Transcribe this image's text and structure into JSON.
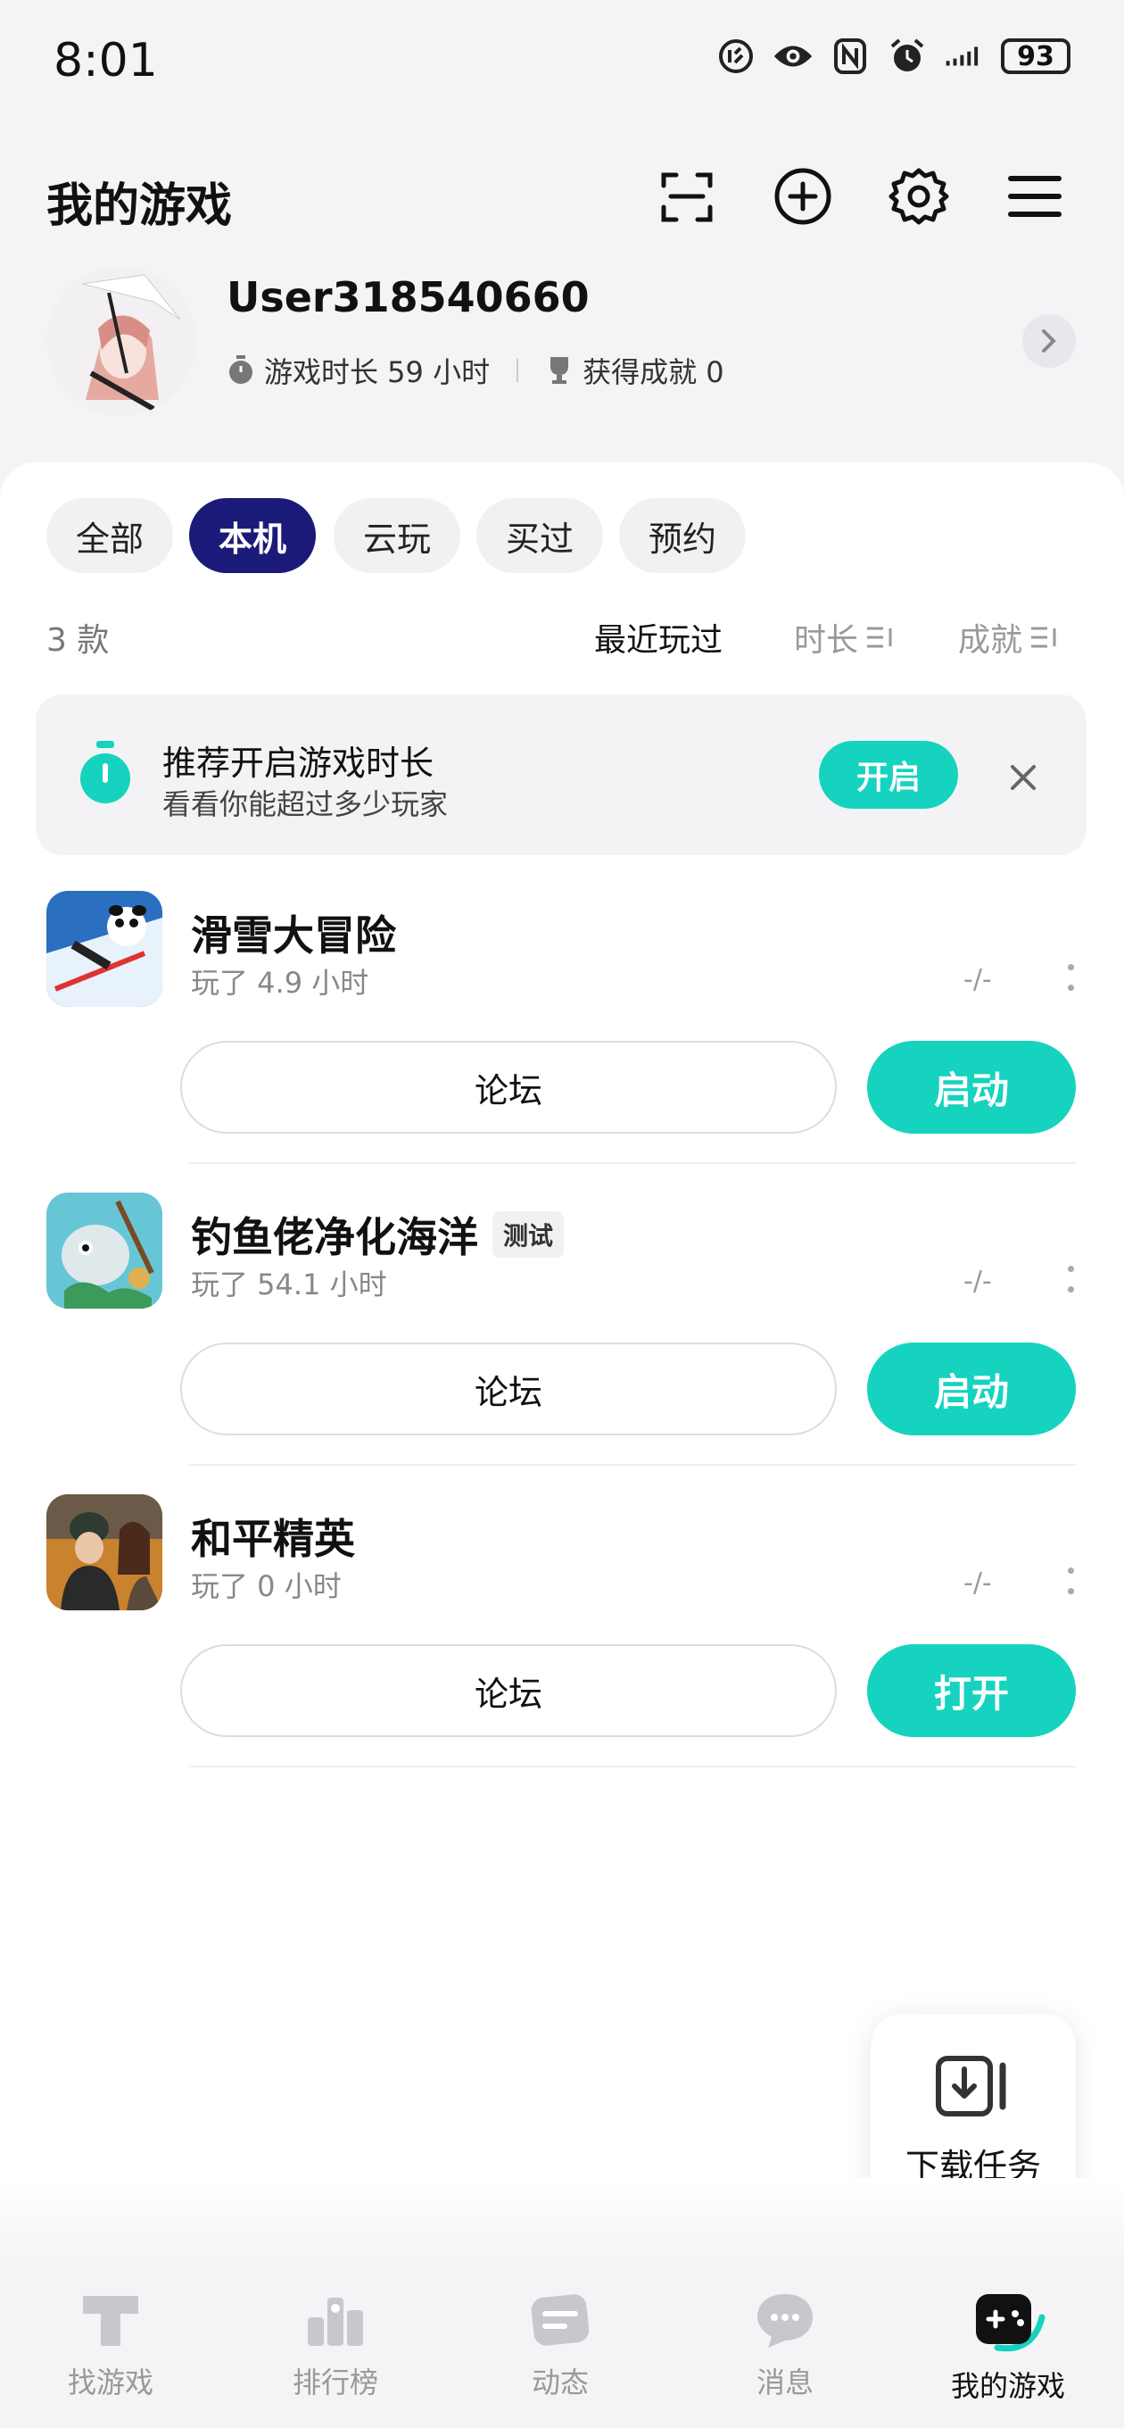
{
  "status_bar": {
    "time": "8:01",
    "battery": "93"
  },
  "header": {
    "title": "我的游戏"
  },
  "profile": {
    "username": "User318540660",
    "play_time": "游戏时长 59 小时",
    "achievements": "获得成就 0"
  },
  "tabs": [
    {
      "label": "全部",
      "active": false
    },
    {
      "label": "本机",
      "active": true
    },
    {
      "label": "云玩",
      "active": false
    },
    {
      "label": "买过",
      "active": false
    },
    {
      "label": "预约",
      "active": false
    }
  ],
  "list_meta": {
    "count": "3 款",
    "sort_recent": "最近玩过",
    "sort_duration": "时长",
    "sort_achievement": "成就"
  },
  "banner": {
    "title": "推荐开启游戏时长",
    "subtitle": "看看你能超过多少玩家",
    "button": "开启"
  },
  "games": [
    {
      "name": "滑雪大冒险",
      "tag": "",
      "played": "玩了 4.9 小时",
      "score": "-/-",
      "forum": "论坛",
      "action": "启动"
    },
    {
      "name": "钓鱼佬净化海洋",
      "tag": "测试",
      "played": "玩了 54.1 小时",
      "score": "-/-",
      "forum": "论坛",
      "action": "启动"
    },
    {
      "name": "和平精英",
      "tag": "",
      "played": "玩了 0 小时",
      "score": "-/-",
      "forum": "论坛",
      "action": "打开"
    }
  ],
  "download": {
    "label": "下载任务"
  },
  "nav": [
    {
      "label": "找游戏",
      "icon": "find-game-icon"
    },
    {
      "label": "排行榜",
      "icon": "ranking-icon"
    },
    {
      "label": "动态",
      "icon": "feed-icon"
    },
    {
      "label": "消息",
      "icon": "message-icon"
    },
    {
      "label": "我的游戏",
      "icon": "my-games-icon"
    }
  ],
  "colors": {
    "accent": "#15d3bf",
    "active_tab": "#1c1a78"
  }
}
